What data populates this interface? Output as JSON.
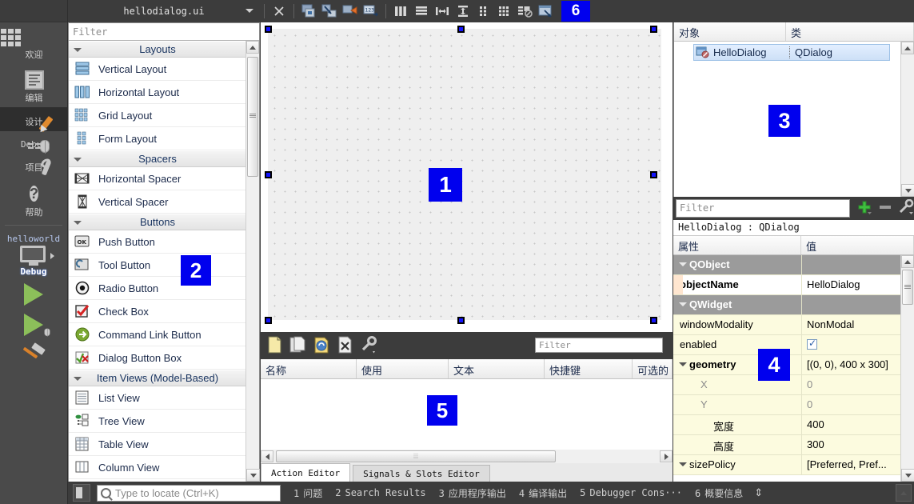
{
  "app": {
    "file_tab": "hellodialog.ui"
  },
  "modebar": {
    "items": [
      {
        "label": "欢迎",
        "icon": "grid-icon",
        "active": false
      },
      {
        "label": "编辑",
        "icon": "document-icon",
        "active": false
      },
      {
        "label": "设计",
        "icon": "pencil-icon",
        "active": true
      },
      {
        "label": "Debug",
        "icon": "bug-icon",
        "active": false
      },
      {
        "label": "项目",
        "icon": "wrench-icon",
        "active": false
      },
      {
        "label": "帮助",
        "icon": "question-icon",
        "active": false
      }
    ],
    "kit": {
      "project": "helloworld",
      "build_config": "Debug"
    },
    "run_buttons": [
      "run-icon",
      "debug-run-icon",
      "build-hammer-icon"
    ]
  },
  "toolbar": {
    "buttons": [
      {
        "name": "close-editor-button",
        "icon": "close-x-icon"
      },
      {
        "name": "edit-widgets-button",
        "icon": "edit-widgets-icon"
      },
      {
        "name": "edit-signals-slots-button",
        "icon": "signals-slots-icon"
      },
      {
        "name": "edit-buddies-button",
        "icon": "buddies-icon"
      },
      {
        "name": "edit-tab-order-button",
        "icon": "tab-order-icon"
      },
      {
        "name": "layout-horizontally-button",
        "icon": "layout-horizontal-icon"
      },
      {
        "name": "layout-vertically-button",
        "icon": "layout-vertical-icon"
      },
      {
        "name": "layout-splitter-horizontal-button",
        "icon": "splitter-horizontal-icon"
      },
      {
        "name": "layout-splitter-vertical-button",
        "icon": "splitter-vertical-icon"
      },
      {
        "name": "layout-form-button",
        "icon": "form-layout-icon"
      },
      {
        "name": "layout-grid-button",
        "icon": "grid-layout-icon"
      },
      {
        "name": "break-layout-button",
        "icon": "break-layout-icon"
      },
      {
        "name": "adjust-size-button",
        "icon": "adjust-size-icon"
      }
    ]
  },
  "widgetbox": {
    "filter_placeholder": "Filter",
    "groups": [
      {
        "title": "Layouts",
        "items": [
          {
            "label": "Vertical Layout",
            "icon": "vertical-layout-icon"
          },
          {
            "label": "Horizontal Layout",
            "icon": "horizontal-layout-icon"
          },
          {
            "label": "Grid Layout",
            "icon": "grid-layout-icon"
          },
          {
            "label": "Form Layout",
            "icon": "form-layout-icon"
          }
        ]
      },
      {
        "title": "Spacers",
        "items": [
          {
            "label": "Horizontal Spacer",
            "icon": "horizontal-spacer-icon"
          },
          {
            "label": "Vertical Spacer",
            "icon": "vertical-spacer-icon"
          }
        ]
      },
      {
        "title": "Buttons",
        "items": [
          {
            "label": "Push Button",
            "icon": "push-button-icon"
          },
          {
            "label": "Tool Button",
            "icon": "tool-button-icon"
          },
          {
            "label": "Radio Button",
            "icon": "radio-button-icon"
          },
          {
            "label": "Check Box",
            "icon": "check-box-icon"
          },
          {
            "label": "Command Link Button",
            "icon": "command-link-icon"
          },
          {
            "label": "Dialog Button Box",
            "icon": "dialog-button-box-icon"
          }
        ]
      },
      {
        "title": "Item Views (Model-Based)",
        "items": [
          {
            "label": "List View",
            "icon": "list-view-icon"
          },
          {
            "label": "Tree View",
            "icon": "tree-view-icon"
          },
          {
            "label": "Table View",
            "icon": "table-view-icon"
          },
          {
            "label": "Column View",
            "icon": "column-view-icon"
          }
        ]
      }
    ]
  },
  "object_inspector": {
    "columns": [
      "对象",
      "类"
    ],
    "rows": [
      {
        "object": "HelloDialog",
        "class": "QDialog",
        "selected": true
      }
    ]
  },
  "property_filter": {
    "placeholder": "Filter",
    "buttons": [
      "add-icon",
      "remove-icon",
      "configure-icon"
    ]
  },
  "property_editor": {
    "title": "HelloDialog : QDialog",
    "columns": [
      "属性",
      "值"
    ],
    "rows": [
      {
        "kind": "group",
        "key": "QObject",
        "value": ""
      },
      {
        "kind": "bold",
        "key": "objectName",
        "value": "HelloDialog"
      },
      {
        "kind": "group",
        "key": "QWidget",
        "value": ""
      },
      {
        "kind": "normal",
        "key": "windowModality",
        "value": "NonModal"
      },
      {
        "kind": "checkbox",
        "key": "enabled",
        "value": "checked"
      },
      {
        "kind": "nest",
        "key": "geometry",
        "value": "[(0, 0), 400 x 300]"
      },
      {
        "kind": "sub",
        "key": "X",
        "value": "0"
      },
      {
        "kind": "sub",
        "key": "Y",
        "value": "0"
      },
      {
        "kind": "subn",
        "key": "宽度",
        "value": "400"
      },
      {
        "kind": "subn",
        "key": "高度",
        "value": "300"
      },
      {
        "kind": "nest2",
        "key": "sizePolicy",
        "value": "[Preferred, Pref..."
      }
    ]
  },
  "action_editor": {
    "toolbar_buttons": [
      {
        "name": "new-action-button",
        "icon": "new-document-icon"
      },
      {
        "name": "copy-action-button",
        "icon": "copy-icon"
      },
      {
        "name": "paste-action-button",
        "icon": "paste-icon"
      },
      {
        "name": "delete-action-button",
        "icon": "delete-document-icon"
      },
      {
        "name": "configure-action-button",
        "icon": "wrench-icon"
      }
    ],
    "filter_placeholder": "Filter",
    "columns": [
      "名称",
      "使用",
      "文本",
      "快捷键",
      "可选的"
    ],
    "rows": [],
    "tabs": [
      {
        "label": "Action Editor",
        "active": true
      },
      {
        "label": "Signals & Slots Editor",
        "active": false
      }
    ]
  },
  "statusbar": {
    "locate_placeholder": "Type to locate (Ctrl+K)",
    "panes": [
      {
        "num": "1",
        "label": "问题"
      },
      {
        "num": "2",
        "label": "Search Results"
      },
      {
        "num": "3",
        "label": "应用程序输出"
      },
      {
        "num": "4",
        "label": "编译输出"
      },
      {
        "num": "5",
        "label": "Debugger Cons···"
      },
      {
        "num": "6",
        "label": "概要信息"
      }
    ]
  },
  "markers": [
    {
      "id": "1",
      "area": "form-canvas"
    },
    {
      "id": "2",
      "area": "widget-box"
    },
    {
      "id": "3",
      "area": "object-inspector"
    },
    {
      "id": "4",
      "area": "property-editor"
    },
    {
      "id": "5",
      "area": "action-editor"
    },
    {
      "id": "6",
      "area": "designer-toolbar"
    }
  ],
  "colors": {
    "marker_blue": "#0000ee",
    "chrome_dark": "#3c3c3c",
    "mode_bar": "#4a4a4a",
    "property_yellow": "#fcfbdf",
    "selection_blue": "#cde0f7"
  }
}
